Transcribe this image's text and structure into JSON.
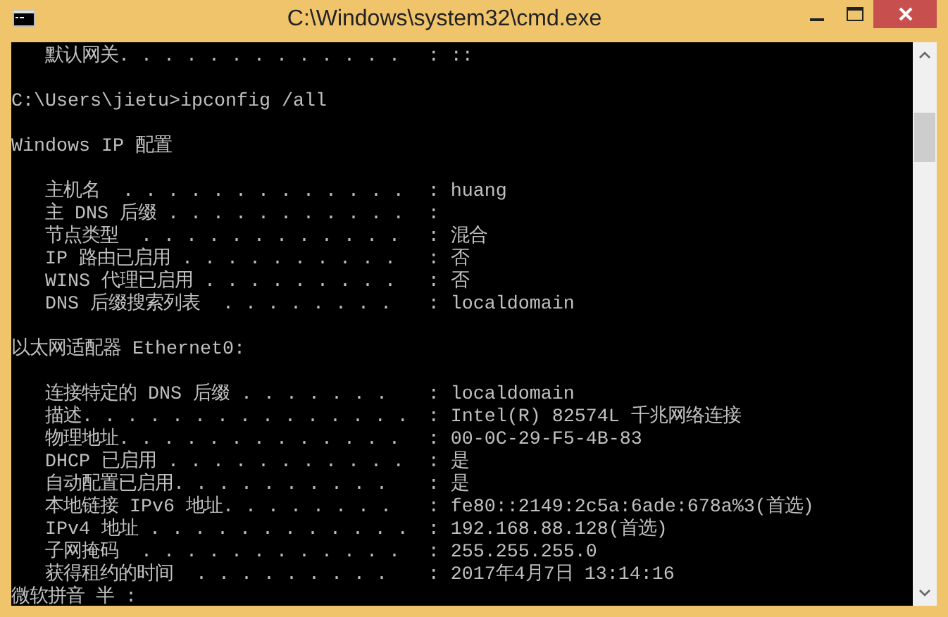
{
  "window": {
    "title": "C:\\Windows\\system32\\cmd.exe"
  },
  "console": {
    "lines": [
      {
        "kind": "field",
        "label": "默认网关. . . . . . . . . . . . . ",
        "value": ": ::"
      },
      {
        "kind": "blank"
      },
      {
        "kind": "text",
        "text": "C:\\Users\\jietu>ipconfig /all"
      },
      {
        "kind": "blank"
      },
      {
        "kind": "text",
        "text": "Windows IP 配置"
      },
      {
        "kind": "blank"
      },
      {
        "kind": "field",
        "label": "主机名  . . . . . . . . . . . . . ",
        "value": ": huang"
      },
      {
        "kind": "field",
        "label": "主 DNS 后缀 . . . . . . . . . . . ",
        "value": ":"
      },
      {
        "kind": "field",
        "label": "节点类型  . . . . . . . . . . . . ",
        "value": ": 混合"
      },
      {
        "kind": "field",
        "label": "IP 路由已启用 . . . . . . . . . . ",
        "value": ": 否"
      },
      {
        "kind": "field",
        "label": "WINS 代理已启用 . . . . . . . . . ",
        "value": ": 否"
      },
      {
        "kind": "field",
        "label": "DNS 后缀搜索列表  . . . . . . . . ",
        "value": ": localdomain"
      },
      {
        "kind": "blank"
      },
      {
        "kind": "text",
        "text": "以太网适配器 Ethernet0:"
      },
      {
        "kind": "blank"
      },
      {
        "kind": "field",
        "label": "连接特定的 DNS 后缀 . . . . . . . ",
        "value": ": localdomain"
      },
      {
        "kind": "field",
        "label": "描述. . . . . . . . . . . . . . . ",
        "value": ": Intel(R) 82574L 千兆网络连接"
      },
      {
        "kind": "field",
        "label": "物理地址. . . . . . . . . . . . . ",
        "value": ": 00-0C-29-F5-4B-83"
      },
      {
        "kind": "field",
        "label": "DHCP 已启用 . . . . . . . . . . . ",
        "value": ": 是"
      },
      {
        "kind": "field",
        "label": "自动配置已启用. . . . . . . . . . ",
        "value": ": 是"
      },
      {
        "kind": "field",
        "label": "本地链接 IPv6 地址. . . . . . . . ",
        "value": ": fe80::2149:2c5a:6ade:678a%3(首选)"
      },
      {
        "kind": "field",
        "label": "IPv4 地址 . . . . . . . . . . . . ",
        "value": ": 192.168.88.128(首选)"
      },
      {
        "kind": "field",
        "label": "子网掩码  . . . . . . . . . . . . ",
        "value": ": 255.255.255.0"
      },
      {
        "kind": "field",
        "label": "获得租约的时间  . . . . . . . . . ",
        "value": ": 2017年4月7日 13:14:16"
      },
      {
        "kind": "text",
        "text": "微软拼音 半 :"
      }
    ]
  }
}
